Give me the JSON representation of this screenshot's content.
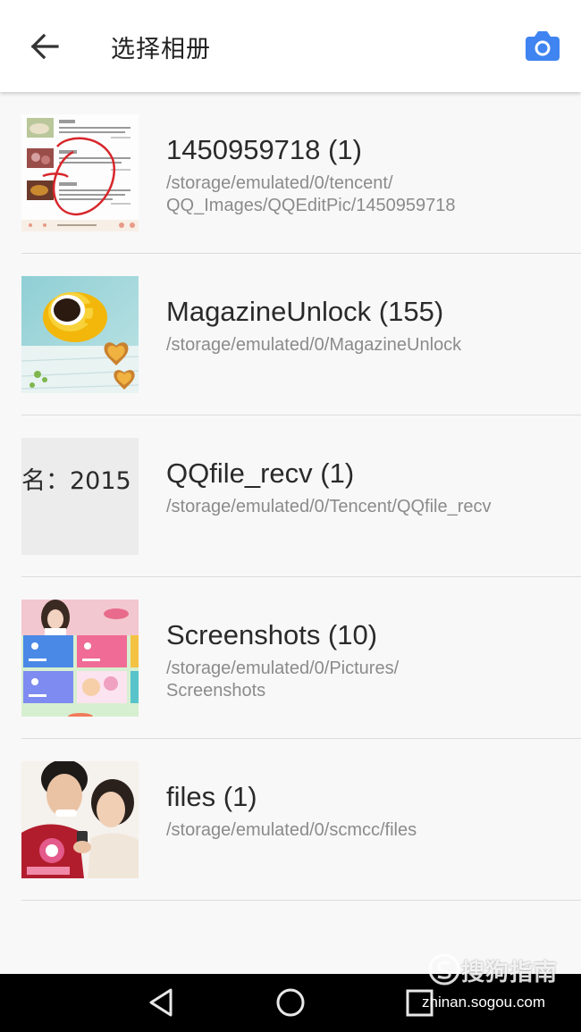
{
  "appbar": {
    "title": "选择相册",
    "back_icon": "arrow-left-icon",
    "camera_icon": "camera-icon",
    "accent": "#3f84f0"
  },
  "albums": [
    {
      "name": "1450959718 (1)",
      "path": "/storage/emulated/0/tencent/\nQQ_Images/QQEditPic/1450959718"
    },
    {
      "name": "MagazineUnlock (155)",
      "path": "/storage/emulated/0/MagazineUnlock"
    },
    {
      "name": "QQfile_recv (1)",
      "path": "/storage/emulated/0/Tencent/QQfile_recv",
      "thumb_text": "名：2015"
    },
    {
      "name": "Screenshots (10)",
      "path": "/storage/emulated/0/Pictures/\nScreenshots"
    },
    {
      "name": "files (1)",
      "path": "/storage/emulated/0/scmcc/files"
    }
  ],
  "navbar": {
    "back": "triangle-back-icon",
    "home": "circle-home-icon",
    "recents": "square-recents-icon"
  },
  "watermark": {
    "brand": "搜狗指南",
    "url": "zhinan.sogou.com"
  }
}
